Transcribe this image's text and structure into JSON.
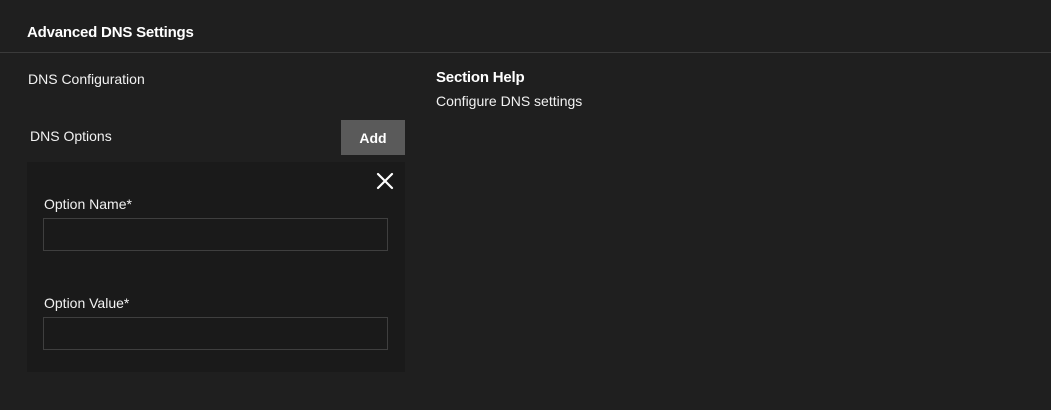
{
  "section": {
    "title": "Advanced DNS Settings"
  },
  "form": {
    "dns_configuration_label": "DNS Configuration",
    "dns_options_label": "DNS Options",
    "add_button_label": "Add",
    "option": {
      "name_label": "Option Name",
      "name_required": "*",
      "name_value": "",
      "value_label": "Option Value",
      "value_required": "*",
      "value_value": "",
      "close_icon": "close-icon"
    }
  },
  "help": {
    "title": "Section Help",
    "text": "Configure DNS settings"
  },
  "colors": {
    "background": "#1f1f1f",
    "card_background": "#1a1a1a",
    "button_background": "#5a5a5a",
    "divider": "#3a3a3a",
    "text": "#ffffff"
  }
}
